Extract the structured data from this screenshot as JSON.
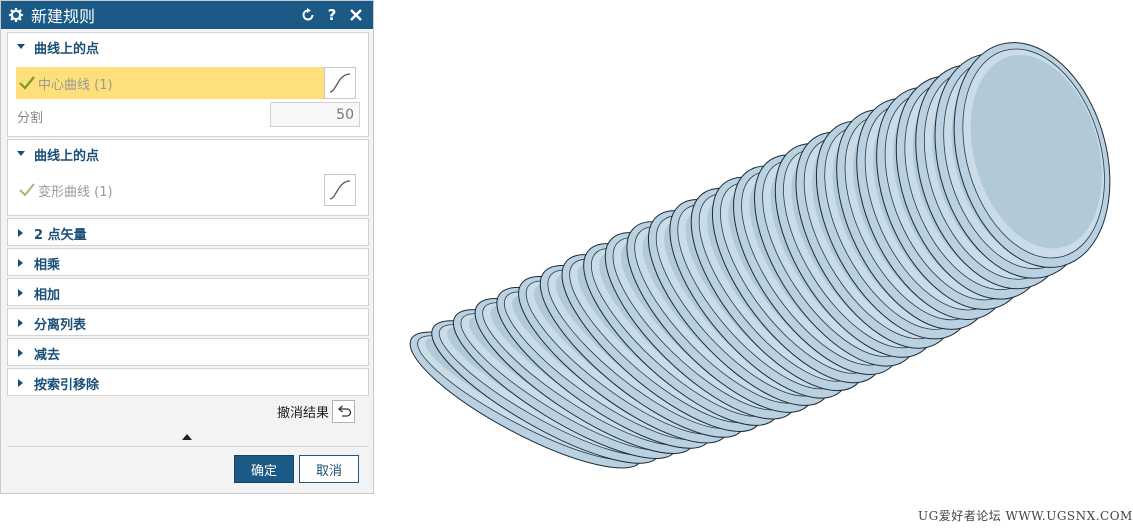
{
  "dialog": {
    "title": "新建规则",
    "groups": [
      {
        "label": "曲线上的点",
        "expanded": true,
        "selection": "中心曲线 (1)",
        "active": true,
        "segment_label": "分割",
        "segment_value": "50"
      },
      {
        "label": "曲线上的点",
        "expanded": true,
        "selection": "变形曲线 (1)",
        "active": false
      }
    ],
    "collapsed_groups": [
      "2 点矢量",
      "相乘",
      "相加",
      "分离列表",
      "减去",
      "按索引移除"
    ],
    "undo_label": "撤消结果",
    "ok_label": "确定",
    "cancel_label": "取消"
  },
  "watermark": "UG爱好者论坛 WWW.UGSNX.COM",
  "colors": {
    "title_bar": "#1b5a86",
    "active_selection": "#fde07a",
    "group_label": "#1a4f77",
    "model_surface": "#b9d1e1"
  },
  "model": {
    "ring_count": 27
  }
}
